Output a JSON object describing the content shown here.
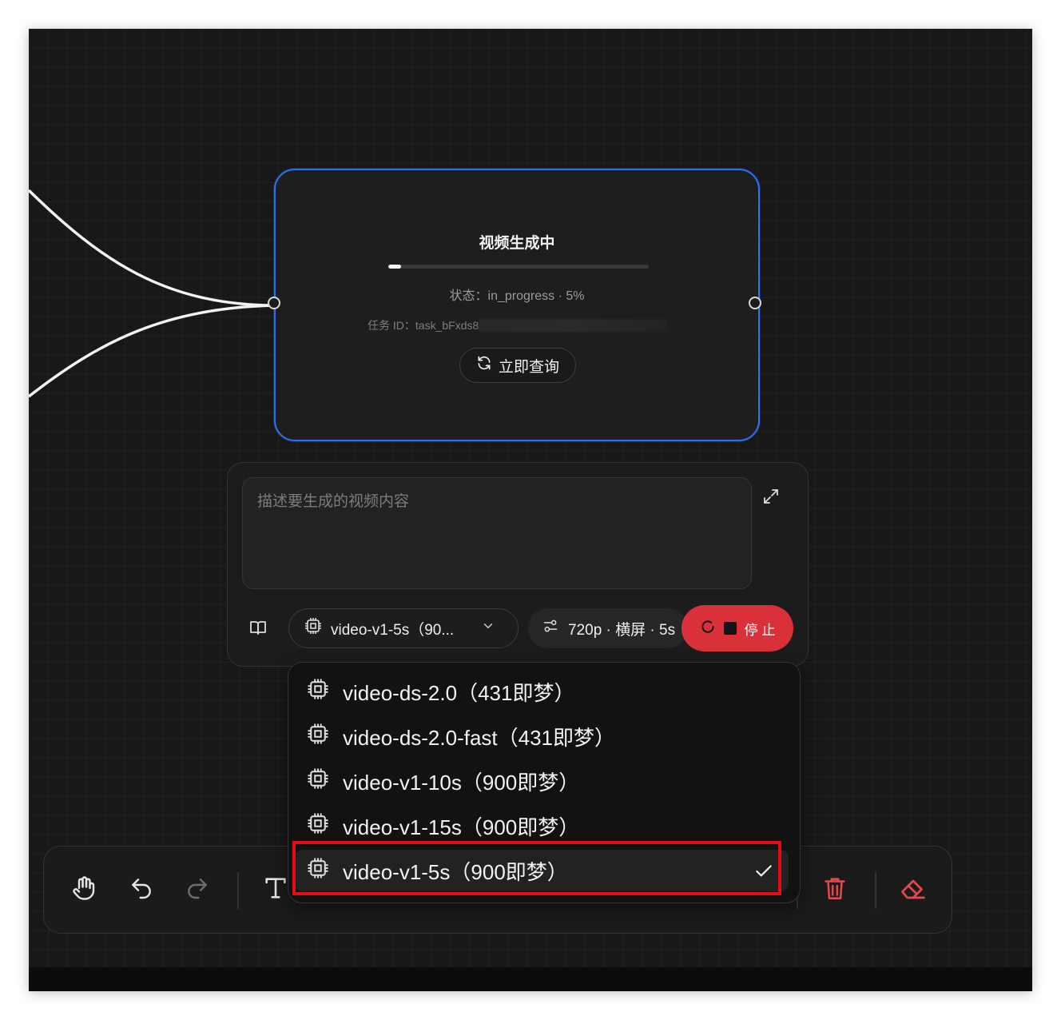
{
  "node": {
    "title": "视频生成中",
    "progress_percent": 5,
    "status_text": "状态：in_progress · 5%",
    "task_id_text": "任务 ID：task_bFxds8",
    "query_button_label": "立即查询"
  },
  "prompt": {
    "placeholder": "描述要生成的视频内容",
    "value": ""
  },
  "controls": {
    "model_select_label": "video-v1-5s（90...",
    "settings_label": "720p · 横屏 · 5s",
    "stop_button_label": "停 止"
  },
  "model_dropdown": {
    "options": [
      "video-ds-2.0（431即梦）",
      "video-ds-2.0-fast（431即梦）",
      "video-v1-10s（900即梦）",
      "video-v1-15s（900即梦）",
      "video-v1-5s（900即梦）"
    ],
    "selected": "video-v1-5s（900即梦）"
  },
  "toolbar": {
    "tools": [
      "hand-icon",
      "undo-icon",
      "redo-icon",
      "text-icon",
      "trash-icon",
      "eraser-icon"
    ],
    "danger_color": "#e5484d"
  },
  "colors": {
    "canvas_bg": "#181818",
    "node_border": "#2f6ef5",
    "stop_button": "#d9303a",
    "highlight": "#e30d16"
  }
}
